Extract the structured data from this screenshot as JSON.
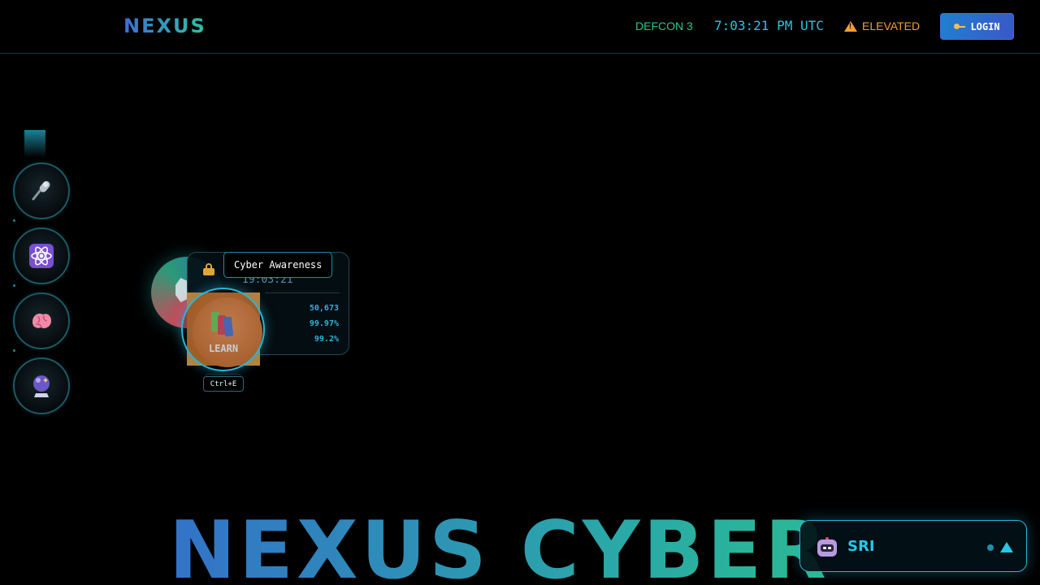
{
  "header": {
    "brand": "NEXUS",
    "defcon": "DEFCON 3",
    "clock": "7:03:21 PM UTC",
    "threat_level": "ELEVATED",
    "login_label": "LOGIN"
  },
  "dock": {
    "items": [
      {
        "name": "voice",
        "icon": "microphone-icon"
      },
      {
        "name": "quantum",
        "icon": "atom-icon"
      },
      {
        "name": "ai",
        "icon": "brain-icon"
      },
      {
        "name": "predict",
        "icon": "crystal-ball-icon"
      }
    ]
  },
  "widget": {
    "tooltip": "Cyber Awareness",
    "card_time": "19:03:21",
    "stats": [
      "50,673",
      "99.97%",
      "99.2%"
    ],
    "learn_label": "LEARN",
    "shortcut": "Ctrl+E"
  },
  "hero": {
    "title": "NEXUS CYBER"
  },
  "assistant": {
    "label": "SRI"
  },
  "colors": {
    "accent": "#27c6e8",
    "warning": "#f0a030",
    "success": "#2ec48a",
    "login": "#1f7fd0"
  }
}
